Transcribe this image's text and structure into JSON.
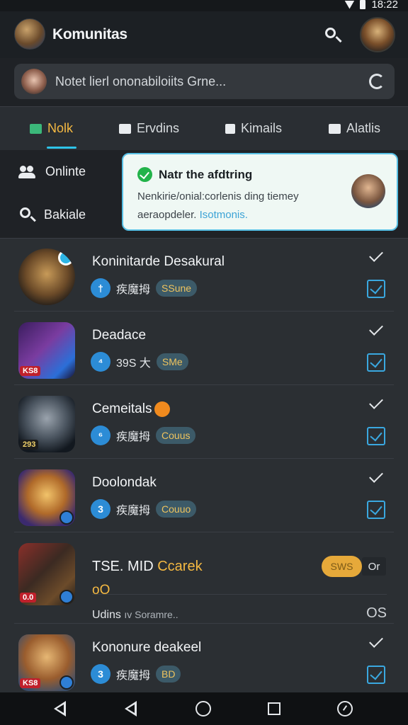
{
  "status_bar": {
    "time": "18:22"
  },
  "app_bar": {
    "title": "Komunitas"
  },
  "search": {
    "placeholder": "Notet lierl ononabiloiits Grne..."
  },
  "tabs": [
    {
      "label": "Nolk",
      "active": true,
      "icon": "chat-icon"
    },
    {
      "label": "Ervdins",
      "active": false,
      "icon": "video-icon"
    },
    {
      "label": "Kimails",
      "active": false,
      "icon": "album-icon"
    },
    {
      "label": "Alatlis",
      "active": false,
      "icon": "mail-icon"
    }
  ],
  "side_menu": [
    {
      "label": "Onlinte",
      "icon": "people-icon"
    },
    {
      "label": "Bakiale",
      "icon": "search-icon"
    }
  ],
  "notification": {
    "title": "Natr the afdtring",
    "body": "Nenkirie/onial:corlenis ding tiemey aeraopdeler.",
    "link": "Isotmonis."
  },
  "games": [
    {
      "title": "Koninitarde Desakural",
      "meta_number": "†",
      "meta_text": "疾魔拇",
      "pill": "SSune"
    },
    {
      "title": "Deadace",
      "meta_number": "⁴",
      "meta_text": "39S 大",
      "pill": "SMe",
      "corner_tag": "KS8"
    },
    {
      "title": "Cemeitals",
      "meta_number": "⁶",
      "meta_text": "疾魔拇",
      "pill": "Couus",
      "corner_tag": "293"
    },
    {
      "title": "Doolondak",
      "meta_number": "3",
      "meta_text": "疾魔拇",
      "pill": "Couuo"
    },
    {
      "title_prefix": "TSE. MID",
      "title_accent": "Ccarek",
      "subtitle": "oO",
      "detail": "Udins",
      "detail_small": "ıv Soramre..",
      "pill": "SWS",
      "small_button": "Or",
      "right_text": "OS",
      "corner_tag": "0.0"
    },
    {
      "title": "Kononure deakeel",
      "meta_number": "3",
      "meta_text": "疾魔拇",
      "pill": "BD",
      "corner_tag": "KS8"
    }
  ],
  "colors": {
    "accent": "#f5b942",
    "link": "#3ca3d6",
    "tab_indicator": "#2ec4e9",
    "check": "#3aa8e0"
  }
}
